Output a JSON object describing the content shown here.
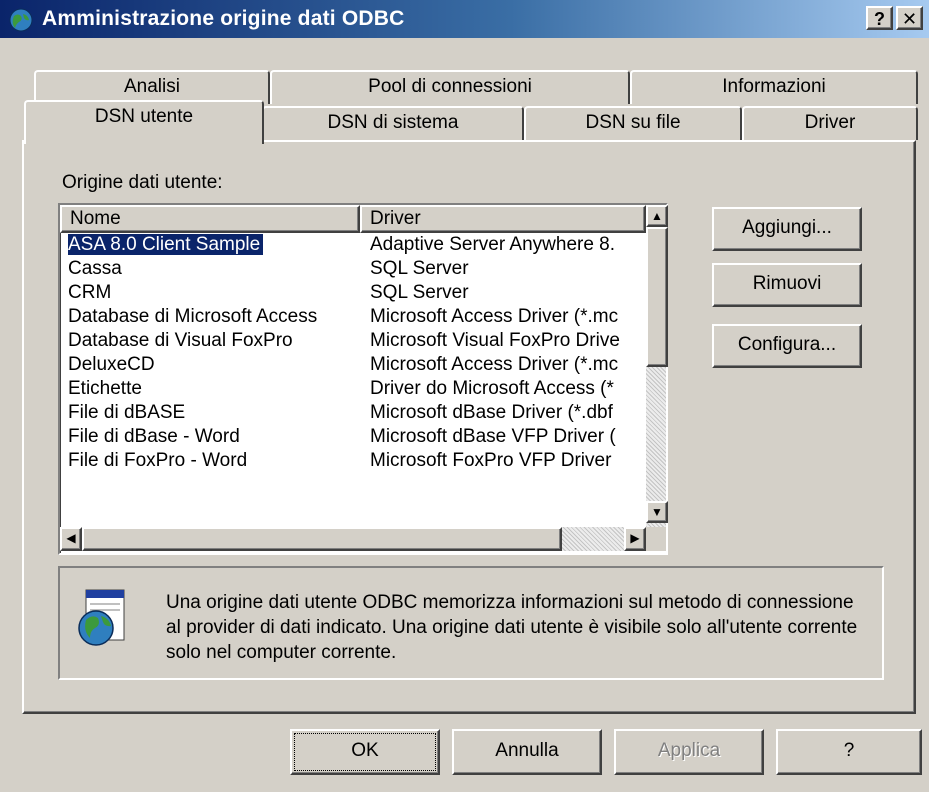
{
  "window": {
    "title": "Amministrazione origine dati ODBC",
    "help_button": "?",
    "close_button": "✕",
    "titlebar_start": "#0a246a",
    "titlebar_end": "#a6caf0"
  },
  "tabs": {
    "back_row": [
      "Analisi",
      "Pool di connessioni",
      "Informazioni"
    ],
    "front_row": [
      "DSN utente",
      "DSN di sistema",
      "DSN su file",
      "Driver"
    ],
    "active": "DSN utente"
  },
  "list": {
    "caption": "Origine dati utente:",
    "columns": [
      "Nome",
      "Driver"
    ],
    "rows": [
      {
        "name": "ASA 8.0 Client Sample",
        "driver": "Adaptive Server Anywhere 8.",
        "selected": true
      },
      {
        "name": "Cassa",
        "driver": "SQL Server"
      },
      {
        "name": "CRM",
        "driver": "SQL Server"
      },
      {
        "name": "Database di Microsoft Access",
        "driver": "Microsoft Access Driver (*.mc"
      },
      {
        "name": "Database di Visual FoxPro",
        "driver": "Microsoft Visual FoxPro Drive"
      },
      {
        "name": "DeluxeCD",
        "driver": "Microsoft Access Driver (*.mc"
      },
      {
        "name": "Etichette",
        "driver": "Driver do Microsoft Access (*"
      },
      {
        "name": "File di dBASE",
        "driver": "Microsoft dBase Driver (*.dbf"
      },
      {
        "name": "File di dBase - Word",
        "driver": "Microsoft dBase VFP Driver ("
      },
      {
        "name": "File di FoxPro - Word",
        "driver": "Microsoft FoxPro VFP Driver"
      }
    ],
    "selection_color": "#0a246a"
  },
  "side_buttons": {
    "add": "Aggiungi...",
    "remove": "Rimuovi",
    "configure": "Configura..."
  },
  "info": {
    "text": "Una origine dati utente ODBC memorizza informazioni sul metodo di connessione al provider di dati indicato. Una origine dati utente è visibile solo all'utente corrente solo nel computer corrente.",
    "icon": "odbc-globe-icon"
  },
  "footer": {
    "ok": "OK",
    "cancel": "Annulla",
    "apply": "Applica",
    "help": "?"
  }
}
